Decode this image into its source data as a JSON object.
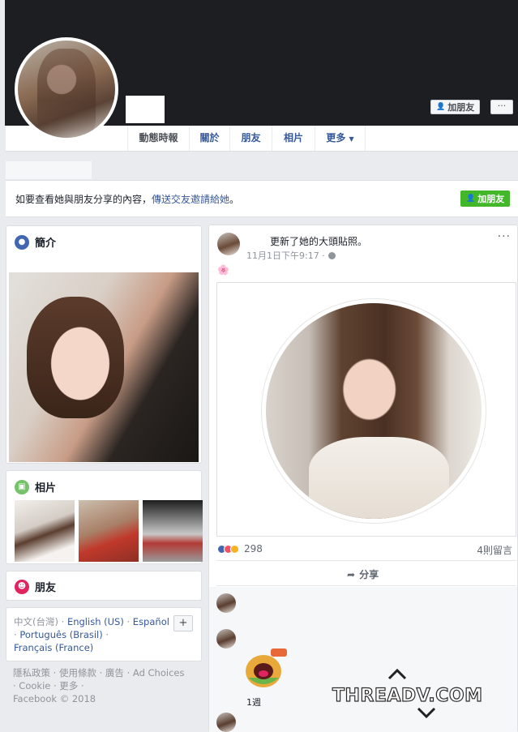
{
  "header": {
    "add_friend_label": "加朋友",
    "more_label": "···"
  },
  "tabs": [
    {
      "label": "動態時報"
    },
    {
      "label": "關於"
    },
    {
      "label": "朋友"
    },
    {
      "label": "相片"
    },
    {
      "label": "更多"
    }
  ],
  "banner": {
    "text_prefix": "如要查看她與朋友分享的內容，",
    "link": "傳送交友邀請給她",
    "text_suffix": "。",
    "add_friend_label": "加朋友"
  },
  "intro": {
    "title": "簡介"
  },
  "photos": {
    "title": "相片"
  },
  "friends": {
    "title": "朋友"
  },
  "languages": {
    "current": "中文(台灣)",
    "sep": " · ",
    "english": "English (US)",
    "espanol": "Español",
    "portugues": "Português (Brasil)",
    "francais": "Français (France)",
    "plus": "+"
  },
  "footer": {
    "line1": "隱私政策 · 使用條款 · 廣告 · Ad Choices",
    "line2": "· Cookie · 更多 ·",
    "line3": "Facebook © 2018"
  },
  "post": {
    "header_text": "更新了她的大頭貼照。",
    "time": "11月1日下午9:17 ·",
    "dots": "···",
    "emoji": "🌸",
    "reaction_count": "298",
    "comment_count": "4則留言",
    "share_label": "分享",
    "one_week": "1週"
  },
  "watermark": "THREADV.COM",
  "colors": {
    "fb_blue": "#365899",
    "green": "#42b72a",
    "cover_bg": "#1c1e21",
    "page_bg": "#e9ebee"
  }
}
